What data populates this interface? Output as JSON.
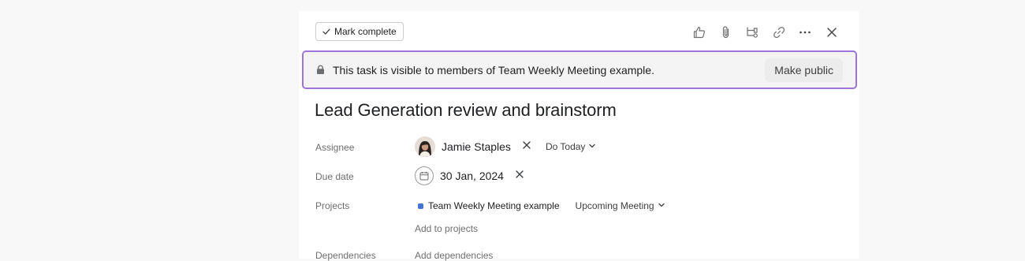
{
  "toolbar": {
    "mark_complete_label": "Mark complete",
    "icons": [
      "thumbs-up-icon",
      "paperclip-icon",
      "subtask-icon",
      "link-icon",
      "more-icon",
      "close-icon"
    ]
  },
  "privacy_banner": {
    "message": "This task is visible to members of Team Weekly Meeting example.",
    "action_label": "Make public",
    "border_color": "#9e74d9"
  },
  "task": {
    "title": "Lead Generation review and brainstorm"
  },
  "fields": {
    "assignee": {
      "label": "Assignee",
      "name": "Jamie Staples",
      "schedule": "Do Today"
    },
    "due_date": {
      "label": "Due date",
      "value": "30 Jan, 2024"
    },
    "projects": {
      "label": "Projects",
      "project_name": "Team Weekly Meeting example",
      "project_color": "#4573d2",
      "section": "Upcoming Meeting",
      "add_label": "Add to projects"
    },
    "dependencies": {
      "label": "Dependencies",
      "add_label": "Add dependencies"
    }
  }
}
